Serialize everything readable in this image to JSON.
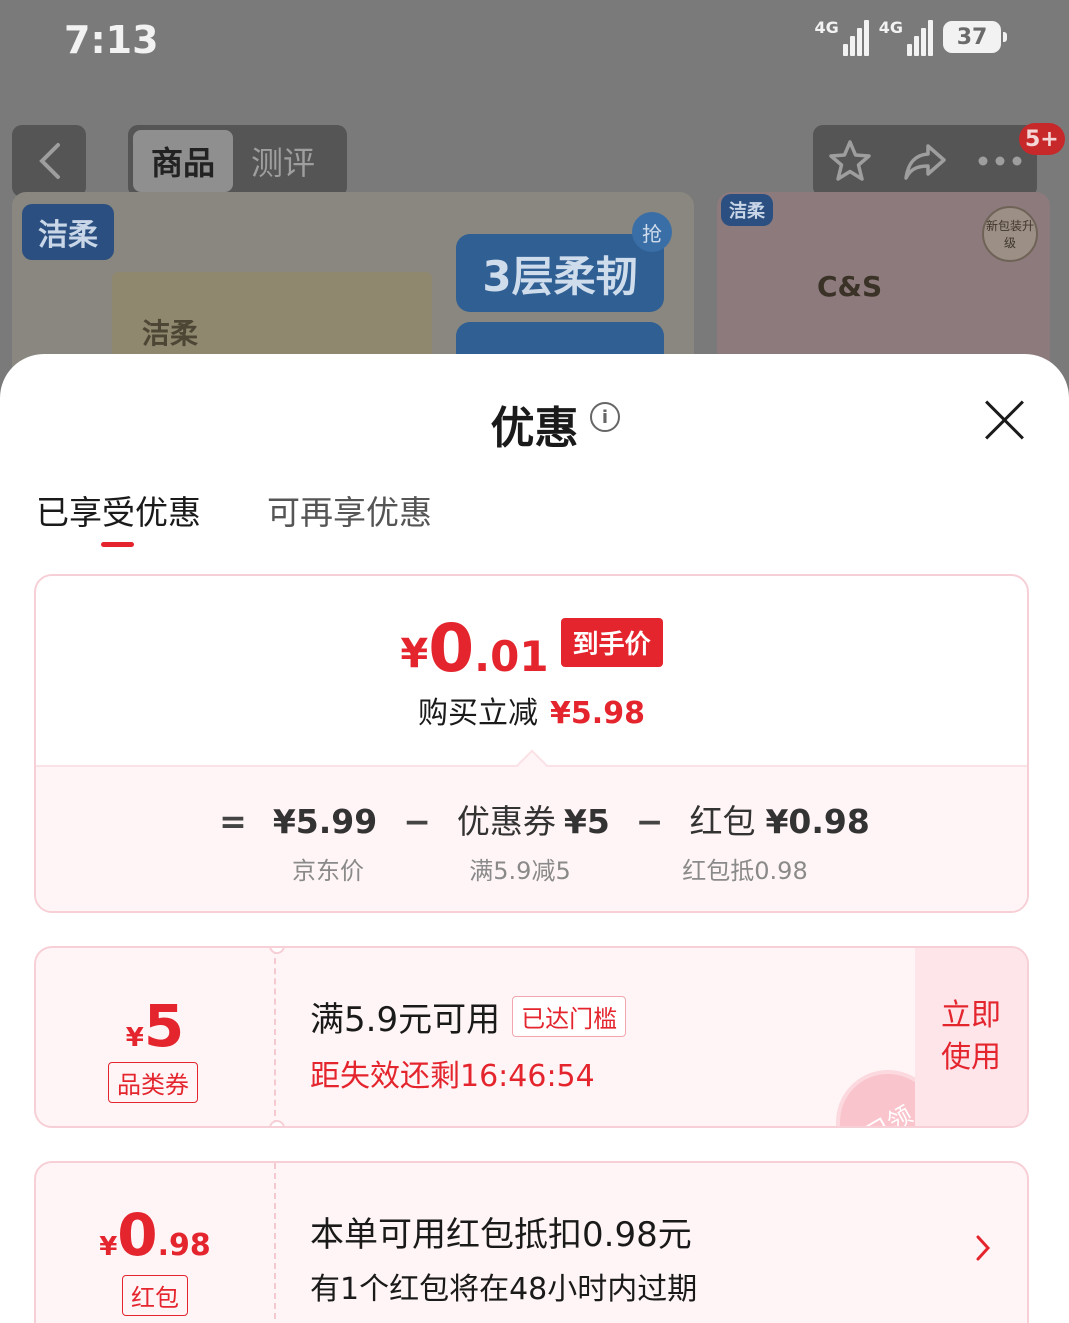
{
  "status_bar": {
    "time": "7:13",
    "network1": "4G",
    "network2": "4G",
    "battery": "37"
  },
  "top_nav": {
    "tabs": [
      {
        "label": "商品",
        "active": true
      },
      {
        "label": "测评",
        "active": false
      }
    ],
    "cart_badge": "5+"
  },
  "product_banner": {
    "brand": "洁柔",
    "brand_logo": "C&S",
    "slogan": "3层柔韧",
    "grab_label": "抢",
    "upgrade_seal": "新包装升级"
  },
  "sheet": {
    "title": "优惠",
    "tabs": [
      {
        "label": "已享受优惠",
        "active": true
      },
      {
        "label": "可再享优惠",
        "active": false
      }
    ]
  },
  "price_card": {
    "currency": "¥",
    "final_int": "0",
    "final_dec": ".01",
    "final_tag": "到手价",
    "reduce_label": "购买立减",
    "reduce_value": "¥5.98",
    "equals": "=",
    "minus": "−",
    "jd_price": "¥5.99",
    "jd_price_label": "京东价",
    "coupon_label": "优惠券",
    "coupon_value": "¥5",
    "coupon_note": "满5.9减5",
    "packet_label": "红包",
    "packet_value": "¥0.98",
    "packet_note": "红包抵0.98"
  },
  "coupon": {
    "currency": "¥",
    "amount": "5",
    "type": "品类券",
    "condition": "满5.9元可用",
    "reached": "已达门槛",
    "countdown": "距失效还剩16:46:54",
    "action": "立即使用",
    "stamp": "已领"
  },
  "red_packet": {
    "currency": "¥",
    "amount_int": "0",
    "amount_dec": ".98",
    "type": "红包",
    "title": "本单可用红包抵扣0.98元",
    "subtitle": "有1个红包将在48小时内过期"
  },
  "colors": {
    "accent": "#e4252e",
    "card_bg": "#fff5f6",
    "card_border": "#f7cfd6"
  }
}
